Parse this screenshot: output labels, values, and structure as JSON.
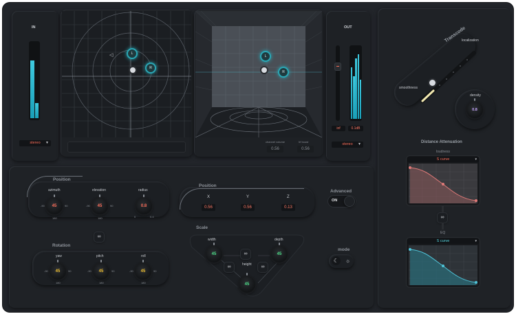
{
  "in_panel": {
    "label": "IN",
    "dropdown": "stereo"
  },
  "out_panel": {
    "label": "OUT",
    "dropdown": "stereo",
    "readout_left": "inf",
    "readout_right": "0.1dB"
  },
  "perspective_view": {
    "channel_volume_label": "channel volume",
    "channel_volume_value": "0.56",
    "hf_boost_label": "hf boost",
    "hf_boost_value": "0.56"
  },
  "sources": {
    "left_marker": "L",
    "right_marker": "R"
  },
  "transcode": {
    "title": "Transcode",
    "localization": "localization",
    "smoothness": "smoothness",
    "density_label": "density",
    "density_value": "0.8"
  },
  "distance": {
    "title": "Distance Attenuation",
    "loudness": "loudness",
    "curve1": "S curve",
    "eq": "EQ",
    "curve2": "S curve",
    "curve1_color": "#e07a78",
    "curve2_color": "#4fc3d8"
  },
  "position": {
    "title": "Position",
    "azimuth": {
      "label": "azimuth",
      "value": "45",
      "min": "-90",
      "max": "90",
      "bottom": "180"
    },
    "elevation": {
      "label": "elevation",
      "value": "45",
      "min": "-90",
      "max": "90",
      "bottom": "180"
    },
    "radius": {
      "label": "radius",
      "value": "0.8",
      "min": "0",
      "max": "0.4"
    }
  },
  "rotation": {
    "title": "Rotation",
    "yaw": {
      "label": "yaw",
      "value": "45",
      "min": "-90",
      "max": "90",
      "bottom": "180"
    },
    "pitch": {
      "label": "pitch",
      "value": "45",
      "min": "-90",
      "max": "90",
      "bottom": "180"
    },
    "roll": {
      "label": "roll",
      "value": "45",
      "min": "-90",
      "max": "90",
      "bottom": "180"
    }
  },
  "position_xyz": {
    "title": "Position",
    "x_label": "X",
    "x": "0.56",
    "y_label": "Y",
    "y": "0.56",
    "z_label": "Z",
    "z": "0.13"
  },
  "scale": {
    "title": "Scale",
    "width": {
      "label": "width",
      "value": "45"
    },
    "depth": {
      "label": "depth",
      "value": "45"
    },
    "height": {
      "label": "height",
      "value": "45"
    }
  },
  "advanced": {
    "label": "Advanced",
    "toggle": "ON"
  },
  "mode": {
    "label": "mode",
    "moon_icon": "☾",
    "sun_icon": "☼"
  },
  "link_icon": "∞",
  "in_meter_levels": [
    0.75,
    0.2
  ],
  "out_meter_levels": [
    0.72,
    0.6,
    0.85,
    0.9,
    0.55
  ]
}
